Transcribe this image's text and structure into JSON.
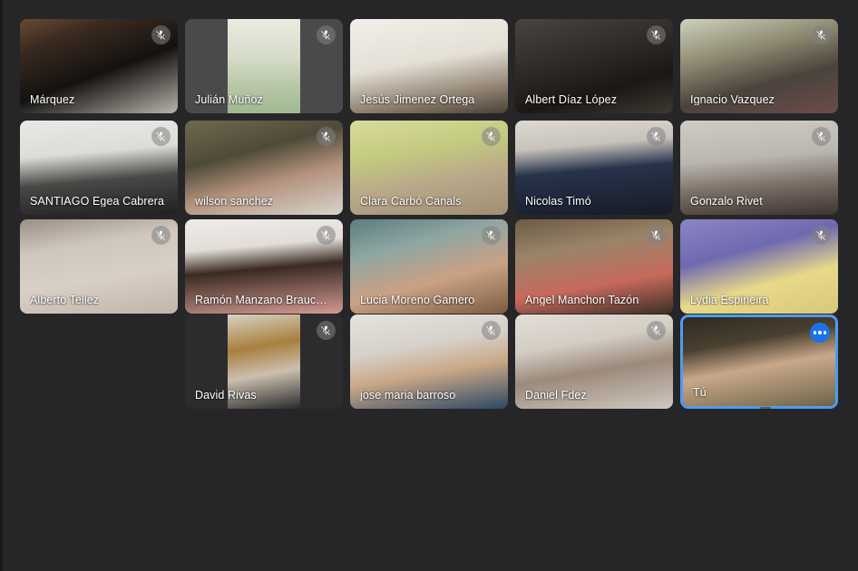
{
  "app": {
    "title": "Video Conference Gallery View",
    "background_color": "#262629",
    "self_highlight_color": "#4e9cf0",
    "more_button_color": "#1a73e8"
  },
  "icons": {
    "mic_muted": "mic-muted-icon",
    "more_options": "more-options-icon"
  },
  "grid": {
    "columns": 5,
    "rows": 4,
    "total_participants": 18
  },
  "participants": [
    {
      "id": "p1",
      "name": "Márquez",
      "muted": true,
      "self": false,
      "row": 1,
      "col": 1,
      "fit": "cover",
      "tone": "dark-brown"
    },
    {
      "id": "p2",
      "name": "Julián Muñoz",
      "muted": true,
      "self": false,
      "row": 1,
      "col": 2,
      "fit": "letterbox",
      "tone": "pale-green"
    },
    {
      "id": "p3",
      "name": "Jesús Jimenez Ortega",
      "muted": false,
      "self": false,
      "row": 1,
      "col": 3,
      "fit": "cover",
      "tone": "white-room"
    },
    {
      "id": "p4",
      "name": "Albert Díaz López",
      "muted": true,
      "self": false,
      "row": 1,
      "col": 4,
      "fit": "cover",
      "tone": "dim-room"
    },
    {
      "id": "p5",
      "name": "Ignacio Vazquez",
      "muted": true,
      "self": false,
      "row": 1,
      "col": 5,
      "fit": "cover",
      "tone": "warm-room"
    },
    {
      "id": "p6",
      "name": "SANTIAGO Egea Cabrera",
      "muted": true,
      "self": false,
      "row": 2,
      "col": 1,
      "fit": "cover",
      "tone": "bright-white"
    },
    {
      "id": "p7",
      "name": "wilson sanchez",
      "muted": true,
      "self": false,
      "row": 2,
      "col": 2,
      "fit": "cover",
      "tone": "olive"
    },
    {
      "id": "p8",
      "name": "Clara Carbó Canals",
      "muted": true,
      "self": false,
      "row": 2,
      "col": 3,
      "fit": "cover",
      "tone": "yellow-green"
    },
    {
      "id": "p9",
      "name": "Nicolas Timó",
      "muted": true,
      "self": false,
      "row": 2,
      "col": 4,
      "fit": "cover",
      "tone": "navy-shelf"
    },
    {
      "id": "p10",
      "name": "Gonzalo Rivet",
      "muted": true,
      "self": false,
      "row": 2,
      "col": 5,
      "fit": "cover",
      "tone": "grey-wall"
    },
    {
      "id": "p11",
      "name": "Alberto Tellez",
      "muted": true,
      "self": false,
      "row": 3,
      "col": 1,
      "fit": "cover",
      "tone": "cap-wall"
    },
    {
      "id": "p12",
      "name": "Ramón Manzano Brauckm...",
      "muted": true,
      "self": false,
      "row": 3,
      "col": 2,
      "fit": "cover",
      "tone": "pink-white"
    },
    {
      "id": "p13",
      "name": "Lucia Moreno Gamero",
      "muted": true,
      "self": false,
      "row": 3,
      "col": 3,
      "fit": "cover",
      "tone": "teal-room"
    },
    {
      "id": "p14",
      "name": "Angel Manchon Tazón",
      "muted": true,
      "self": false,
      "row": 3,
      "col": 4,
      "fit": "cover",
      "tone": "wood-room"
    },
    {
      "id": "p15",
      "name": "Lydia Espiñeira",
      "muted": true,
      "self": false,
      "row": 3,
      "col": 5,
      "fit": "cover",
      "tone": "purple-wall"
    },
    {
      "id": "p16",
      "name": "David Rivas",
      "muted": true,
      "self": false,
      "row": 4,
      "col": 2,
      "fit": "letterbox-dark",
      "tone": "door-room"
    },
    {
      "id": "p17",
      "name": "jose maria barroso",
      "muted": true,
      "self": false,
      "row": 4,
      "col": 3,
      "fit": "cover",
      "tone": "light-wall"
    },
    {
      "id": "p18",
      "name": "Daniel Fdez",
      "muted": true,
      "self": false,
      "row": 4,
      "col": 4,
      "fit": "cover",
      "tone": "pale-wall"
    },
    {
      "id": "p19",
      "name": "Tú",
      "muted": false,
      "self": true,
      "row": 4,
      "col": 5,
      "fit": "cover",
      "tone": "bookshelf"
    }
  ]
}
